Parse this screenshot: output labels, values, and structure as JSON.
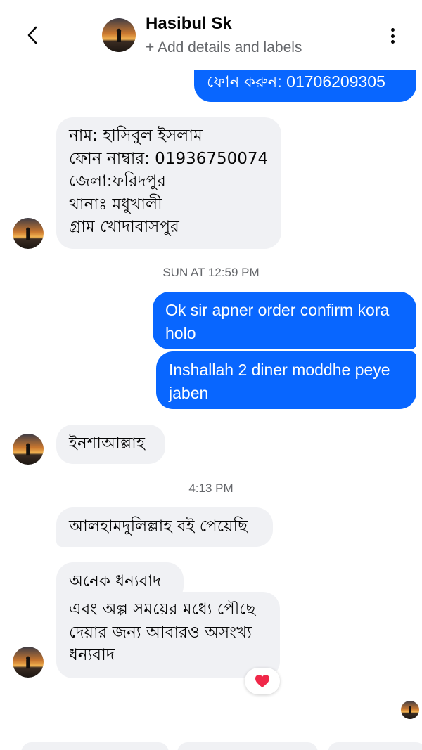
{
  "header": {
    "back_icon": "chevron-left-icon",
    "contact_name": "Hasibul Sk",
    "subtitle": "+ Add details and labels",
    "more_icon": "vertical-ellipsis-icon"
  },
  "messages": [
    {
      "direction": "outgoing",
      "text": "ফোন করুন: 01706209305"
    },
    {
      "direction": "incoming",
      "lines": [
        "নাম: হাসিবুল ইসলাম",
        "ফোন নাম্বার: 01936750074",
        "জেলা:ফরিদপুর",
        "থানাঃ মধুখালী",
        "গ্রাম খোদাবাসপুর"
      ]
    },
    {
      "direction": "outgoing",
      "text": "Ok sir apner order confirm kora holo"
    },
    {
      "direction": "outgoing",
      "text": "Inshallah 2 diner moddhe peye jaben"
    },
    {
      "direction": "incoming",
      "text": "ইনশাআল্লাহ"
    },
    {
      "direction": "incoming",
      "text": "আলহামদুলিল্লাহ বই পেয়েছি"
    },
    {
      "direction": "incoming",
      "text": "অনেক ধন্যবাদ"
    },
    {
      "direction": "incoming",
      "text": "এবং অল্প সময়ের মধ্যে পৌছে দেয়ার জন্য আবারও অসংখ্য ধন্যবাদ"
    }
  ],
  "timestamps": [
    "SUN AT 12:59 PM",
    "4:13 PM"
  ],
  "reaction": {
    "icon": "heart-icon",
    "color": "#f02849"
  },
  "colors": {
    "outgoing": "#0866ff",
    "incoming": "#f0f1f4",
    "secondary_text": "#65676b"
  }
}
